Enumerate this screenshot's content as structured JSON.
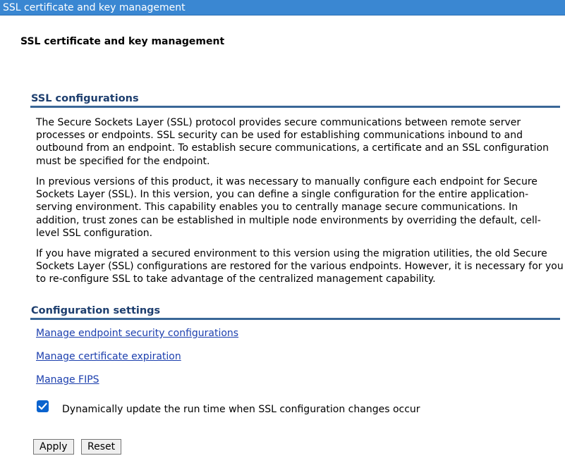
{
  "window": {
    "title": "SSL certificate and key management"
  },
  "page": {
    "title": "SSL certificate and key management"
  },
  "ssl_configurations": {
    "header": "SSL configurations",
    "paragraphs": [
      "The Secure Sockets Layer (SSL) protocol provides secure communications between remote server processes or endpoints. SSL security can be used for establishing communications inbound to and outbound from an endpoint. To establish secure communications, a certificate and an SSL configuration must be specified for the endpoint.",
      "In previous versions of this product, it was necessary to manually configure each endpoint for Secure Sockets Layer (SSL). In this version, you can define a single configuration for the entire application-serving environment. This capability enables you to centrally manage secure communications. In addition, trust zones can be established in multiple node environments by overriding the default, cell-level SSL configuration.",
      "If you have migrated a secured environment to this version using the migration utilities, the old Secure Sockets Layer (SSL) configurations are restored for the various endpoints. However, it is necessary for you to re-configure SSL to take advantage of the centralized management capability."
    ]
  },
  "configuration_settings": {
    "header": "Configuration settings",
    "links": [
      "Manage endpoint security configurations",
      "Manage certificate expiration",
      "Manage FIPS"
    ],
    "dynamic_update": {
      "label": "Dynamically update the run time when SSL configuration changes occur",
      "checked": true
    }
  },
  "actions": {
    "apply_label": "Apply",
    "reset_label": "Reset"
  },
  "colors": {
    "titlebar": "#3a87d2",
    "section_header": "#1d3e6e",
    "link": "#1c3fae",
    "checkbox": "#0b63ce"
  }
}
